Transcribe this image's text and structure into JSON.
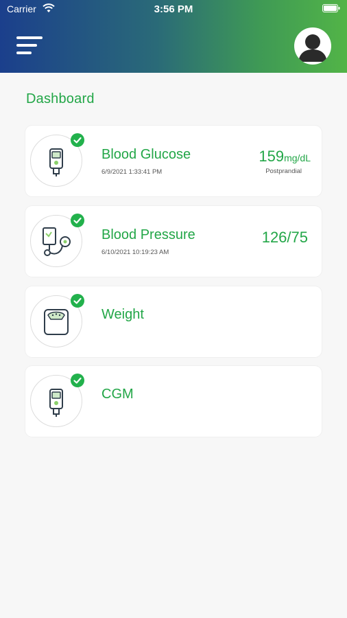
{
  "status_bar": {
    "carrier": "Carrier",
    "time": "3:56 PM"
  },
  "header": {
    "menu_icon": "hamburger-icon",
    "avatar_icon": "user-silhouette-icon"
  },
  "page": {
    "title": "Dashboard"
  },
  "colors": {
    "accent": "#22a647",
    "check": "#22b14c",
    "header_start": "#1b3f8c",
    "header_end": "#52b447",
    "icon_stroke": "#2f3d4a"
  },
  "cards": [
    {
      "title": "Blood Glucose",
      "timestamp": "6/9/2021 1:33:41 PM",
      "value": "159",
      "unit": "mg/dL",
      "note": "Postprandial",
      "icon": "glucometer-icon",
      "status_icon": "check-icon"
    },
    {
      "title": "Blood Pressure",
      "timestamp": "6/10/2021 10:19:23 AM",
      "value": "126/75",
      "icon": "blood-pressure-monitor-icon",
      "status_icon": "check-icon"
    },
    {
      "title": "Weight",
      "icon": "weight-scale-icon",
      "status_icon": "check-icon"
    },
    {
      "title": "CGM",
      "icon": "cgm-device-icon",
      "status_icon": "check-icon"
    }
  ]
}
